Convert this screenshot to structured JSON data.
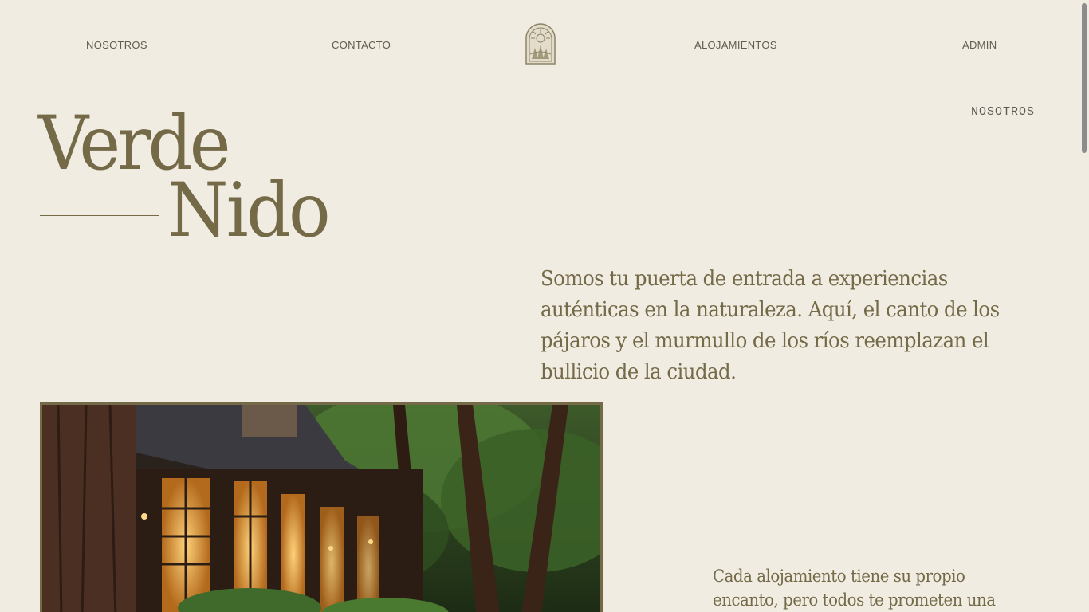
{
  "nav": {
    "items": [
      {
        "label": "NOSOTROS"
      },
      {
        "label": "CONTACTO"
      },
      {
        "label": "ALOJAMIENTOS"
      },
      {
        "label": "ADMIN"
      }
    ],
    "logo_icon": "arched-forest-logo-icon"
  },
  "hero": {
    "section_label": "NOSOTROS",
    "title_line1": "Verde",
    "title_line2": "Nido",
    "intro": "Somos tu puerta de entrada a experiencias auténticas en la naturaleza. Aquí, el canto de los pájaros y el murmullo de los ríos reemplazan el bullicio de la ciudad.",
    "secondary": "Cada alojamiento tiene su propio encanto, pero todos te prometen una"
  },
  "colors": {
    "background": "#f1ece2",
    "accent": "#746a48",
    "nav_text": "#625d4c"
  }
}
